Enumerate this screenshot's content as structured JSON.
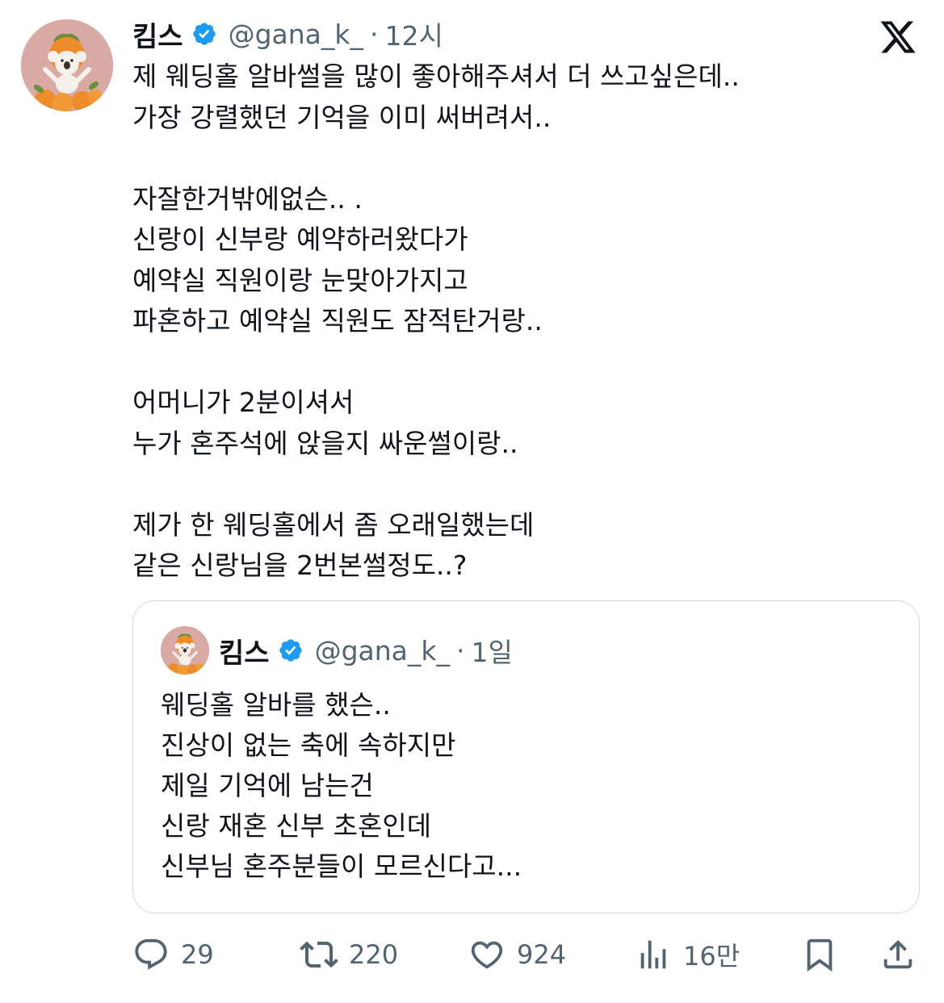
{
  "tweet": {
    "author_name": "킴스",
    "handle": "@gana_k_",
    "separator": "·",
    "time": "12시",
    "text": "제 웨딩홀 알바썰을 많이 좋아해주셔서 더 쓰고싶은데..\n가장 강렬했던 기억을 이미 써버려서..\n\n자잘한거밖에없슨.. .\n신랑이 신부랑 예약하러왔다가\n예약실 직원이랑 눈맞아가지고\n파혼하고 예약실 직원도 잠적탄거랑..\n\n어머니가 2분이셔서\n누가 혼주석에 앉을지 싸운썰이랑..\n\n제가 한 웨딩홀에서 좀 오래일했는데\n같은 신랑님을 2번본썰정도..?"
  },
  "quoted_tweet": {
    "author_name": "킴스",
    "handle": "@gana_k_",
    "separator": "·",
    "time": "1일",
    "text": "웨딩홀 알바를 했슨..\n진상이 없는 축에 속하지만\n제일 기억에 남는건\n신랑 재혼 신부 초혼인데\n신부님 혼주분들이 모르신다고..."
  },
  "actions": {
    "replies": "29",
    "retweets": "220",
    "likes": "924",
    "views": "16만"
  },
  "icons": {
    "verified": "verified-badge-icon",
    "brand": "x-logo-icon",
    "reply": "reply-icon",
    "retweet": "retweet-icon",
    "like": "heart-icon",
    "views": "views-chart-icon",
    "bookmark": "bookmark-icon",
    "share": "share-icon"
  },
  "colors": {
    "verified_blue": "#1d9bf0",
    "secondary_text": "#536471",
    "border": "#cfd9de",
    "avatar_bg": "#d9a9a4"
  }
}
